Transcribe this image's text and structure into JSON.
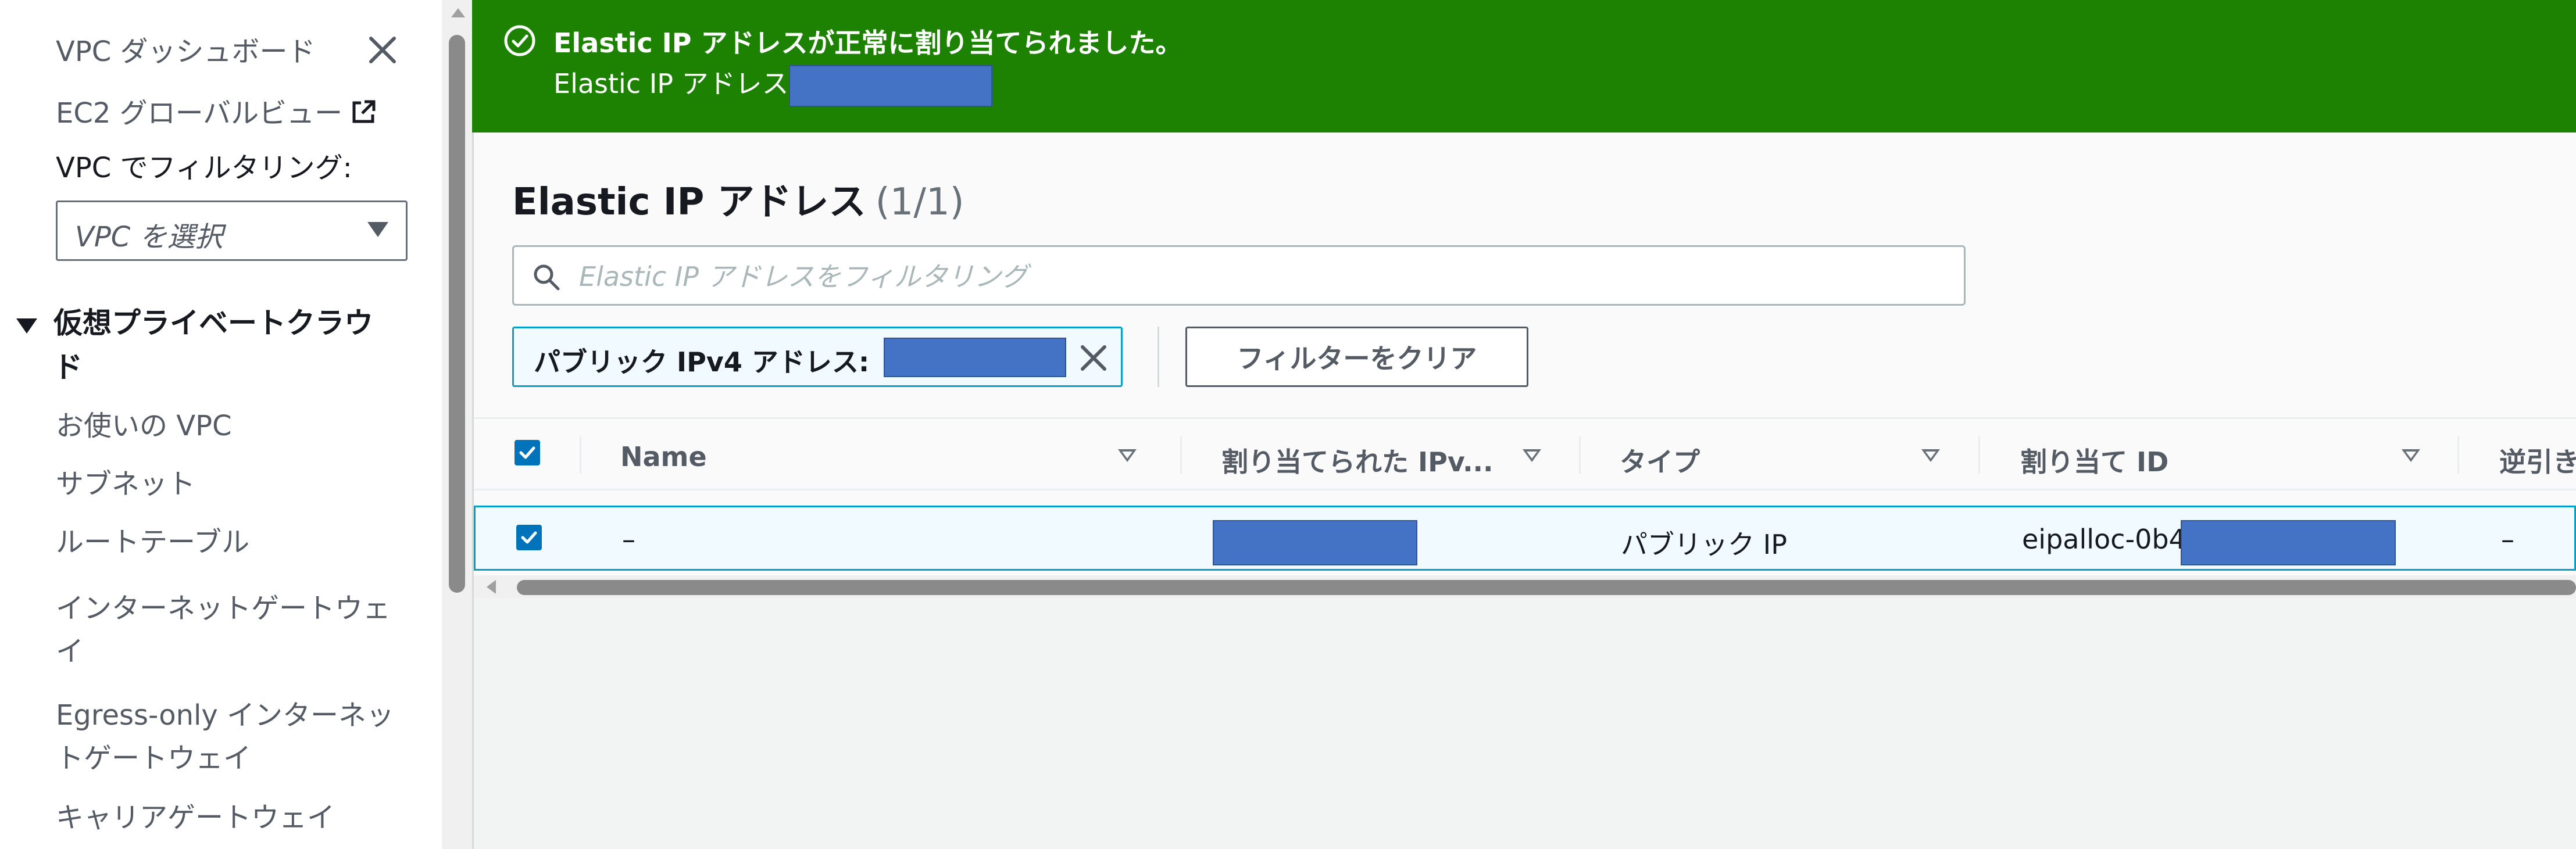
{
  "sidebar": {
    "dashboard": "VPC ダッシュボード",
    "ec2_global": "EC2 グローバルビュー",
    "filter_label": "VPC でフィルタリング:",
    "vpc_select_value": "VPC を選択",
    "section_title": "仮想プライベートクラウド",
    "items": [
      "お使いの VPC",
      "サブネット",
      "ルートテーブル",
      "インターネットゲートウェイ",
      "Egress-only インターネットゲートウェイ",
      "キャリアゲートウェイ"
    ]
  },
  "flash": {
    "title": "Elastic IP アドレスが正常に割り当てられました。",
    "message": "Elastic IP アドレス",
    "color": "#1d8102"
  },
  "main": {
    "heading": "Elastic IP アドレス",
    "count": "(1/1)",
    "search_placeholder": "Elastic IP アドレスをフィルタリング",
    "filter_token_label": "パブリック IPv4 アドレス:",
    "clear_filters": "フィルターをクリア",
    "columns": [
      "Name",
      "割り当てられた IPv...",
      "タイプ",
      "割り当て ID",
      "逆引き"
    ],
    "rows": [
      {
        "name": "–",
        "type": "パブリック IP",
        "allocation_id": "eipalloc-0b4",
        "reverse_dns": "–",
        "selected": true
      }
    ],
    "select_all_checked": true
  },
  "colors": {
    "accent": "#0073bb",
    "selection_border": "#00a1c9",
    "redaction": "#4472c4"
  }
}
